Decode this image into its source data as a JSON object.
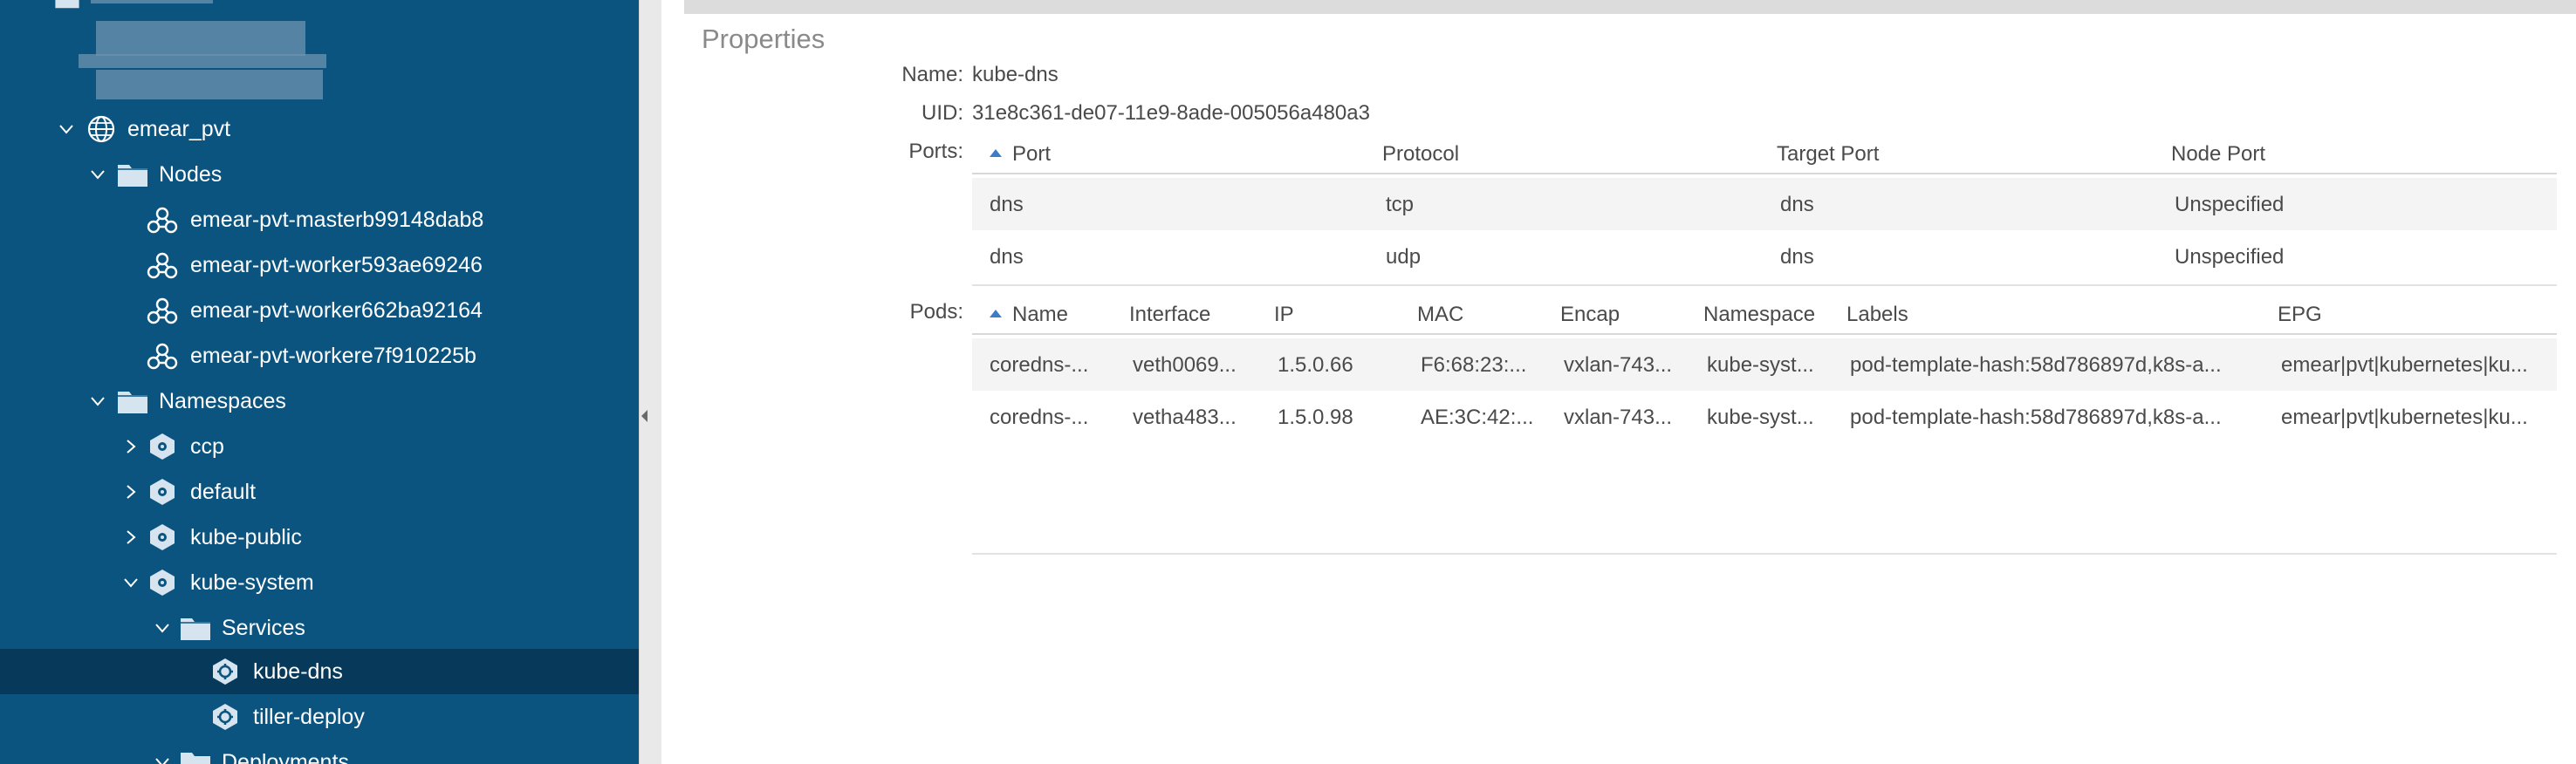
{
  "sidebar": {
    "tree": {
      "cluster": "emear_pvt",
      "nodes_folder": "Nodes",
      "nodes": [
        "emear-pvt-masterb99148dab8",
        "emear-pvt-worker593ae69246",
        "emear-pvt-worker662ba92164",
        "emear-pvt-workere7f910225b"
      ],
      "namespaces_folder": "Namespaces",
      "namespaces": [
        "ccp",
        "default",
        "kube-public",
        "kube-system"
      ],
      "services_folder": "Services",
      "services": [
        "kube-dns",
        "tiller-deploy"
      ],
      "deployments_folder": "Deployments"
    }
  },
  "properties": {
    "title": "Properties",
    "name_label": "Name:",
    "name_value": "kube-dns",
    "uid_label": "UID:",
    "uid_value": "31e8c361-de07-11e9-8ade-005056a480a3",
    "ports_label": "Ports:",
    "pods_label": "Pods:"
  },
  "ports_table": {
    "columns": [
      "Port",
      "Protocol",
      "Target Port",
      "Node Port"
    ],
    "rows": [
      [
        "dns",
        "tcp",
        "dns",
        "Unspecified"
      ],
      [
        "dns",
        "udp",
        "dns",
        "Unspecified"
      ]
    ]
  },
  "pods_table": {
    "columns": [
      "Name",
      "Interface",
      "IP",
      "MAC",
      "Encap",
      "Namespace",
      "Labels",
      "EPG"
    ],
    "rows": [
      [
        "coredns-...",
        "veth0069...",
        "1.5.0.66",
        "F6:68:23:...",
        "vxlan-743...",
        "kube-syst...",
        "pod-template-hash:58d786897d,k8s-a...",
        "emear|pvt|kubernetes|ku..."
      ],
      [
        "coredns-...",
        "vetha483...",
        "1.5.0.98",
        "AE:3C:42:...",
        "vxlan-743...",
        "kube-syst...",
        "pod-template-hash:58d786897d,k8s-a...",
        "emear|pvt|kubernetes|ku..."
      ]
    ]
  },
  "colors": {
    "sidebar_bg": "#0b5480",
    "sidebar_selected": "#073a5a",
    "sort_accent": "#3d7cc9"
  }
}
